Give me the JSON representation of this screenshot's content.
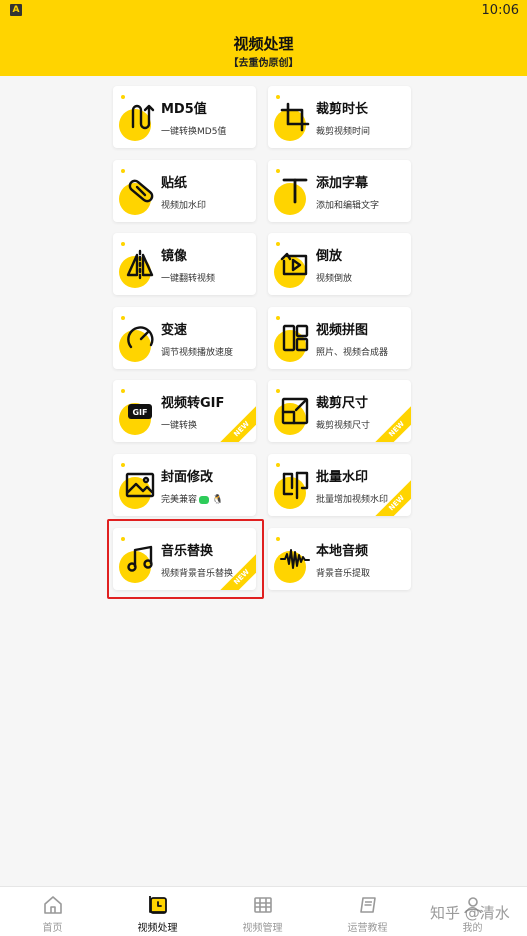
{
  "status": {
    "app_badge": "A",
    "time": "10:06"
  },
  "header": {
    "title": "视频处理",
    "subtitle": "【去重伪原创】"
  },
  "cards": [
    {
      "title": "MD5值",
      "subtitle": "一键转换MD5值",
      "icon": "md5-icon",
      "badge": ""
    },
    {
      "title": "裁剪时长",
      "subtitle": "裁剪视频时间",
      "icon": "crop-icon",
      "badge": ""
    },
    {
      "title": "贴纸",
      "subtitle": "视频加水印",
      "icon": "sticker-icon",
      "badge": ""
    },
    {
      "title": "添加字幕",
      "subtitle": "添加和编辑文字",
      "icon": "text-icon",
      "badge": ""
    },
    {
      "title": "镜像",
      "subtitle": "一键翻转视频",
      "icon": "mirror-icon",
      "badge": ""
    },
    {
      "title": "倒放",
      "subtitle": "视频倒放",
      "icon": "reverse-play-icon",
      "badge": ""
    },
    {
      "title": "变速",
      "subtitle": "调节视频播放速度",
      "icon": "speedometer-icon",
      "badge": ""
    },
    {
      "title": "视频拼图",
      "subtitle": "照片、视频合成器",
      "icon": "collage-icon",
      "badge": ""
    },
    {
      "title": "视频转GIF",
      "subtitle": "一键转换",
      "icon": "gif-icon",
      "badge": "NEW"
    },
    {
      "title": "裁剪尺寸",
      "subtitle": "裁剪视频尺寸",
      "icon": "resize-icon",
      "badge": "NEW"
    },
    {
      "title": "封面修改",
      "subtitle": "完美兼容",
      "icon": "image-icon",
      "badge": ""
    },
    {
      "title": "批量水印",
      "subtitle": "批量增加视频水印",
      "icon": "stamp-icon",
      "badge": "NEW"
    },
    {
      "title": "音乐替换",
      "subtitle": "视频背景音乐替换",
      "icon": "music-note-icon",
      "badge": "NEW"
    },
    {
      "title": "本地音频",
      "subtitle": "背景音乐提取",
      "icon": "waveform-icon",
      "badge": ""
    }
  ],
  "tabs": [
    {
      "label": "首页",
      "icon": "home-icon"
    },
    {
      "label": "视频处理",
      "icon": "video-edit-icon"
    },
    {
      "label": "视频管理",
      "icon": "film-icon"
    },
    {
      "label": "运营教程",
      "icon": "book-icon"
    },
    {
      "label": "我的",
      "icon": "user-icon"
    }
  ],
  "watermark": "知乎 @清水",
  "colors": {
    "accent": "#ffd400",
    "highlight_border": "#e02020",
    "background": "#f6f6f6"
  }
}
